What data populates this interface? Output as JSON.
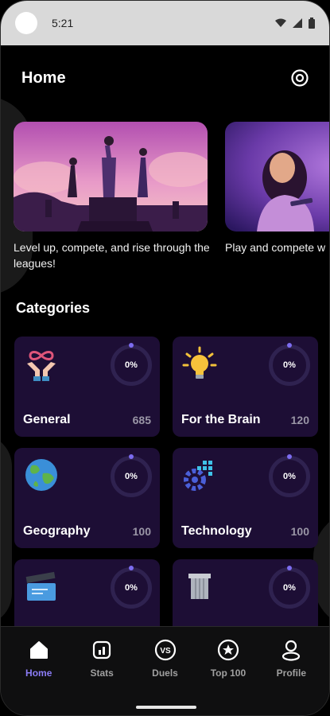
{
  "status_bar": {
    "time": "5:21"
  },
  "header": {
    "title": "Home"
  },
  "banners": [
    {
      "caption": "Level up, compete, and rise through the leagues!"
    },
    {
      "caption": "Play and compete w"
    }
  ],
  "categories": {
    "title": "Categories",
    "items": [
      {
        "name": "General",
        "count": "685",
        "progress": "0%",
        "icon": "infinity-hands-icon"
      },
      {
        "name": "For the Brain",
        "count": "120",
        "progress": "0%",
        "icon": "lightbulb-icon"
      },
      {
        "name": "Geography",
        "count": "100",
        "progress": "0%",
        "icon": "globe-icon"
      },
      {
        "name": "Technology",
        "count": "100",
        "progress": "0%",
        "icon": "gear-chip-icon"
      },
      {
        "name": "",
        "count": "",
        "progress": "0%",
        "icon": "clapperboard-icon"
      },
      {
        "name": "",
        "count": "",
        "progress": "0%",
        "icon": "column-icon"
      }
    ]
  },
  "nav": {
    "items": [
      {
        "label": "Home",
        "icon": "home-icon",
        "active": true
      },
      {
        "label": "Stats",
        "icon": "stats-icon",
        "active": false
      },
      {
        "label": "Duels",
        "icon": "versus-icon",
        "active": false
      },
      {
        "label": "Top 100",
        "icon": "star-badge-icon",
        "active": false
      },
      {
        "label": "Profile",
        "icon": "profile-icon",
        "active": false
      }
    ]
  },
  "colors": {
    "accent": "#8b7cf6",
    "card_bg": "#1d0e35",
    "background": "#000000"
  }
}
